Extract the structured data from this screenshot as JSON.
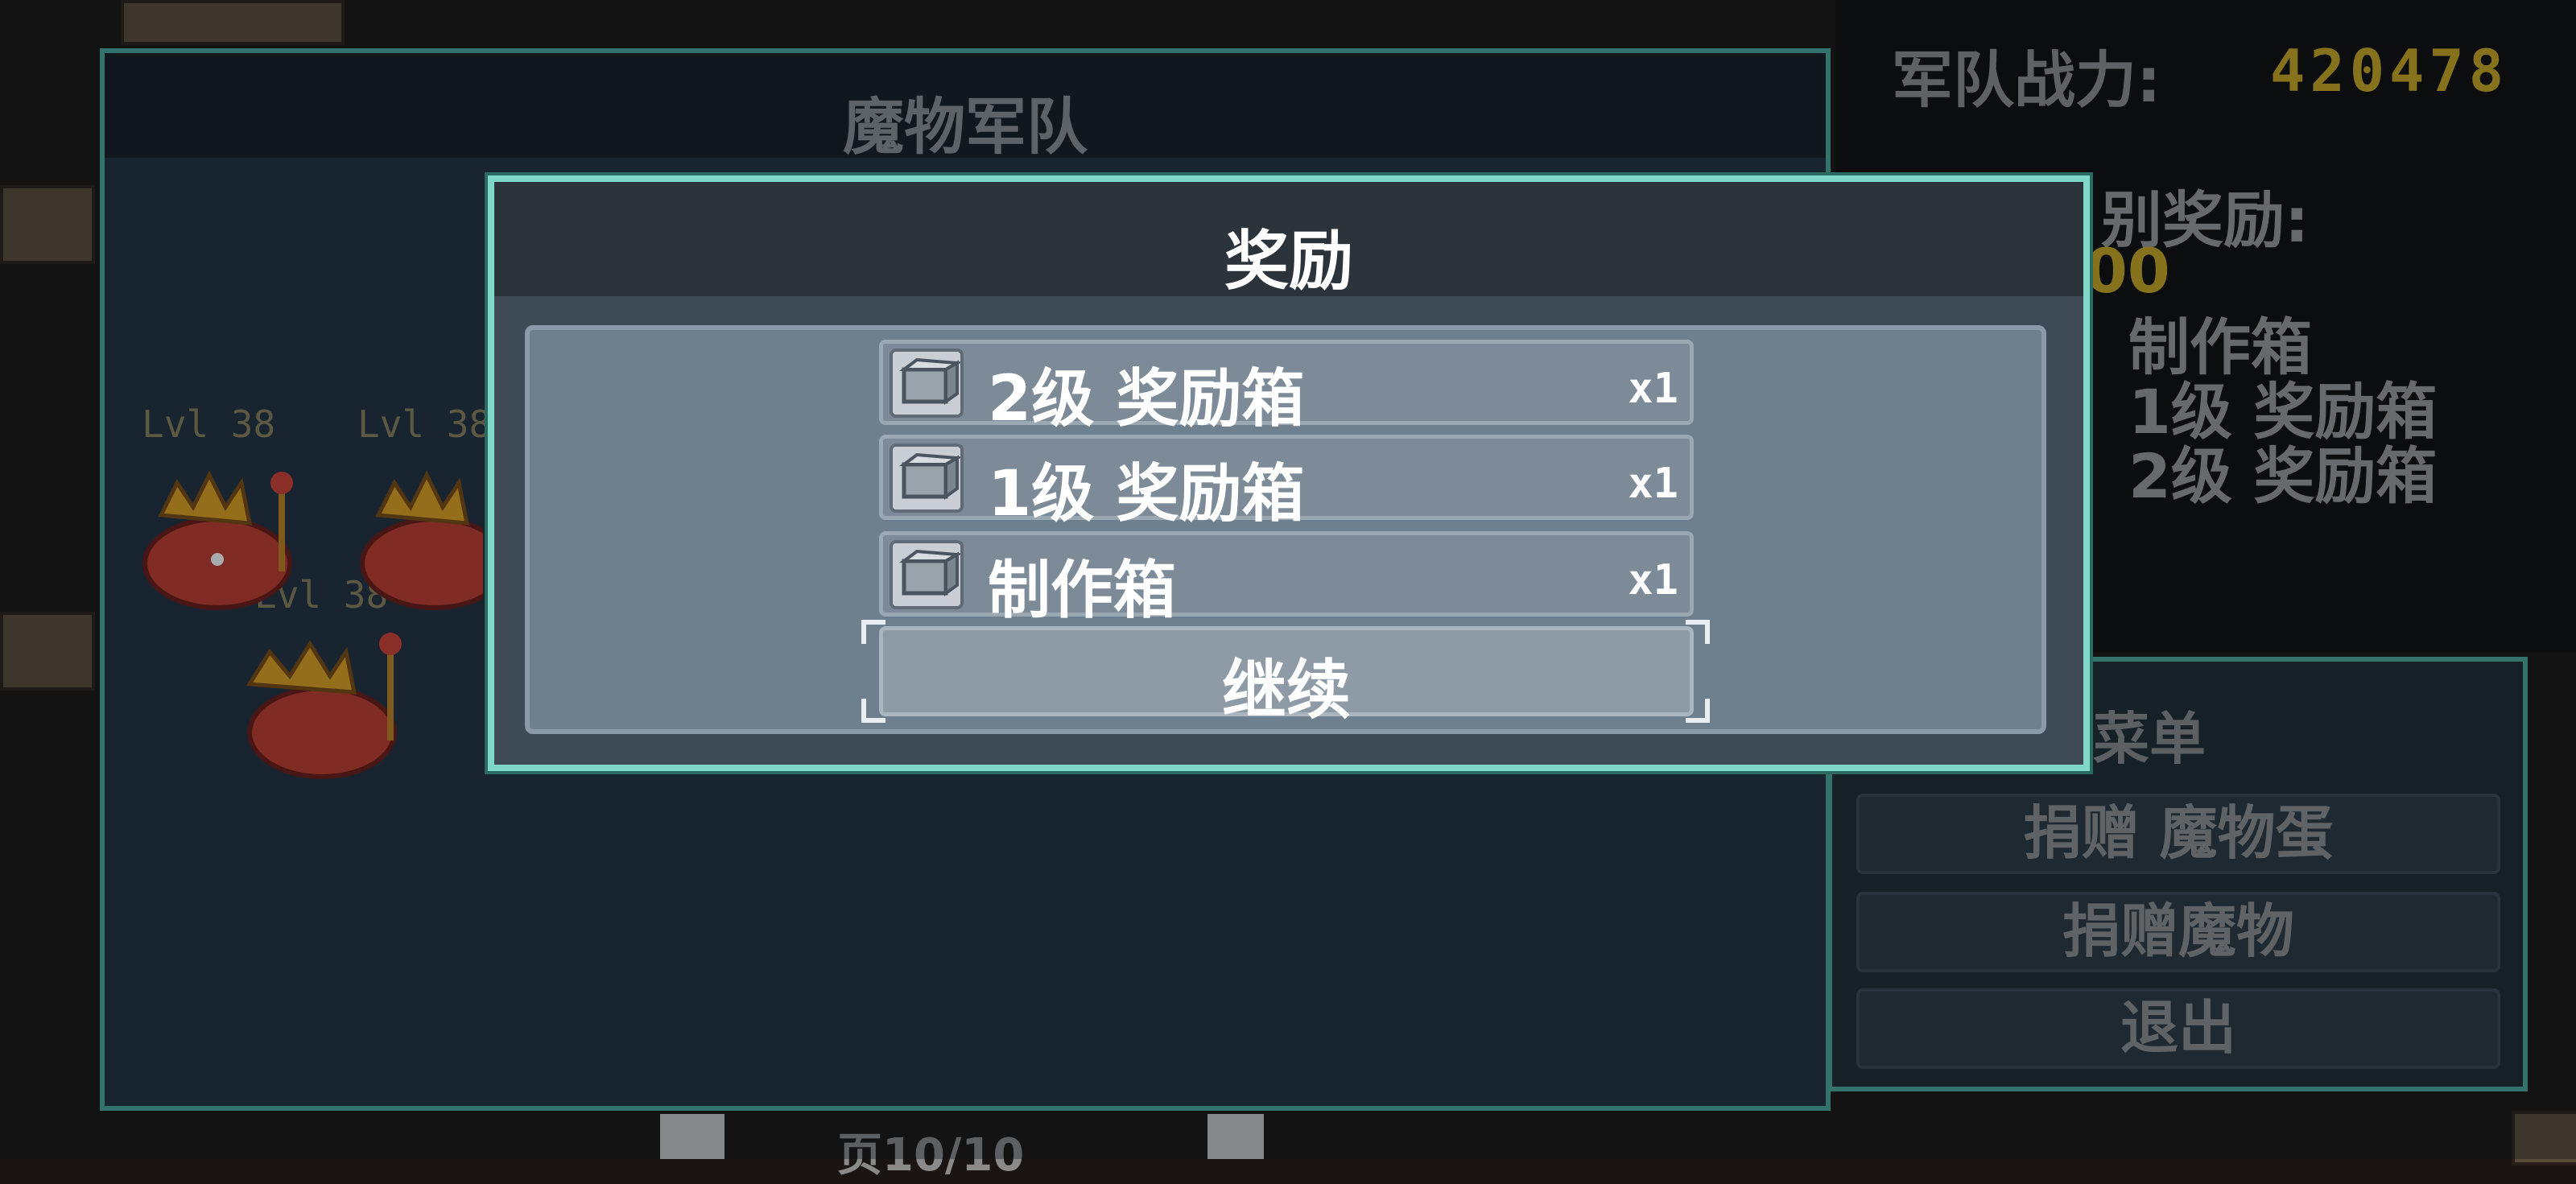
{
  "army_panel": {
    "title": "魔物军队"
  },
  "slimes": [
    {
      "level": "Lvl 38"
    },
    {
      "level": "Lvl 38"
    },
    {
      "level": "Lvl 38"
    }
  ],
  "top_info": {
    "power_label": "军队战力:",
    "power_value": "420478",
    "reward_label_partial": "别奖励:",
    "reward_value_partial": "00",
    "items": [
      "制作箱",
      "1级 奖励箱",
      "2级 奖励箱"
    ]
  },
  "menu": {
    "title": "菜单",
    "buttons": [
      "捐赠 魔物蛋",
      "捐赠魔物",
      "退出"
    ]
  },
  "reward_modal": {
    "title": "奖励",
    "items": [
      {
        "name": "2级 奖励箱",
        "qty": "x1",
        "icon": "chest-icon"
      },
      {
        "name": "1级 奖励箱",
        "qty": "x1",
        "icon": "chest-icon"
      },
      {
        "name": "制作箱",
        "qty": "x1",
        "icon": "chest-icon"
      }
    ],
    "continue_label": "继续"
  },
  "bottom": {
    "page_text": "页10/10"
  },
  "colors": {
    "accent": "#7fd8c8",
    "gold": "#c9a520",
    "slime_red": "#c0392b",
    "crown_gold": "#e0a020"
  }
}
